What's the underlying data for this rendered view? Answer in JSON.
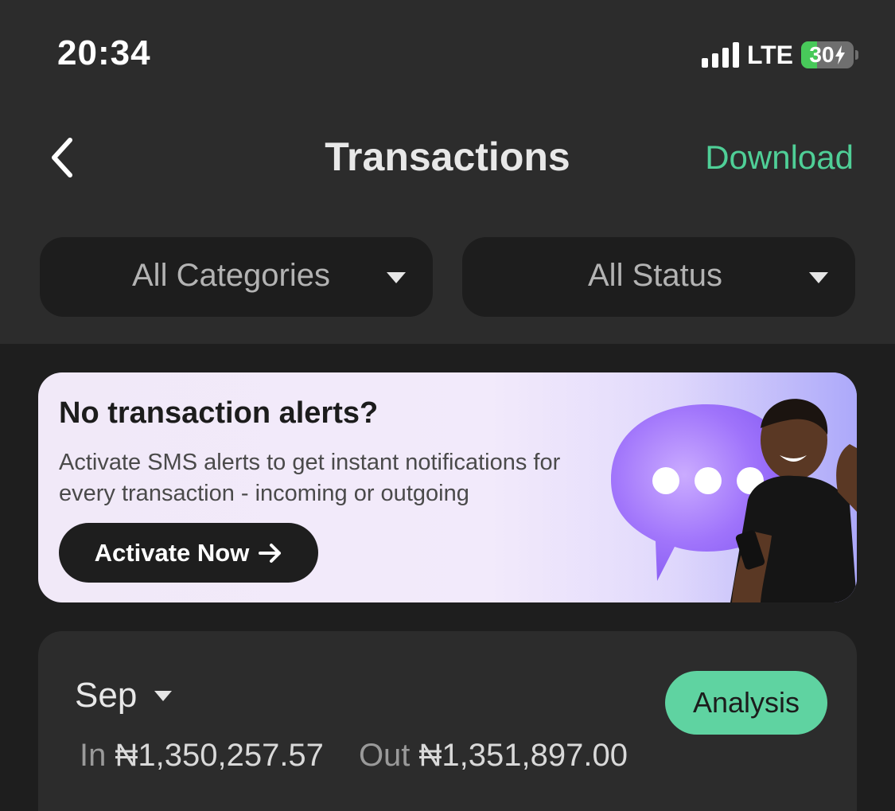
{
  "status_bar": {
    "time": "20:34",
    "network": "LTE",
    "battery": "30",
    "battery_level": 0.3
  },
  "header": {
    "back_icon": "chevron-left-icon",
    "title": "Transactions",
    "download_label": "Download"
  },
  "filters": {
    "category": "All Categories",
    "status": "All Status"
  },
  "banner": {
    "title": "No transaction alerts?",
    "description": "Activate SMS alerts to get instant notifications for every transaction - incoming or outgoing",
    "button_label": "Activate Now",
    "button_icon": "arrow-right-icon"
  },
  "summary": {
    "month": "Sep",
    "analysis_label": "Analysis",
    "in_label": "In",
    "in_amount": "₦1,350,257.57",
    "out_label": "Out",
    "out_amount": "₦1,351,897.00"
  },
  "colors": {
    "accent": "#4fcf97",
    "analysis_bg": "#5fd3a1",
    "background": "#1e1e1e",
    "header_bg": "#2c2c2c"
  }
}
